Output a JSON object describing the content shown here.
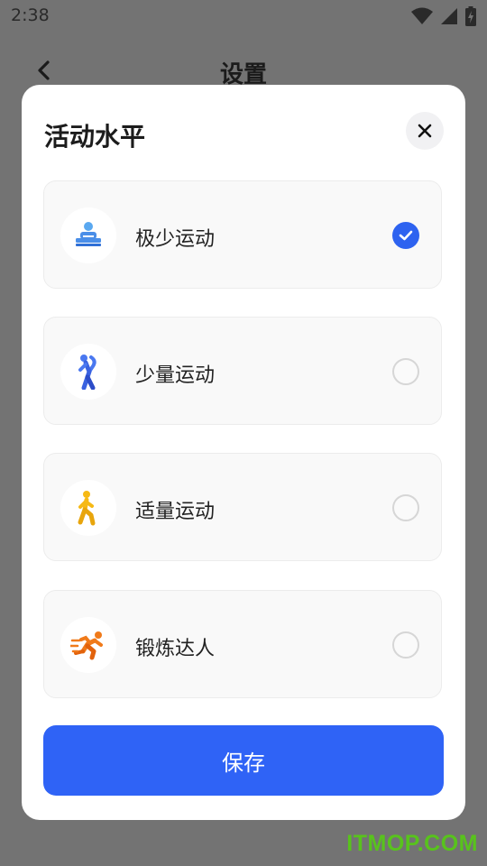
{
  "status_bar": {
    "time": "2:38"
  },
  "app_bar": {
    "title": "设置"
  },
  "sheet": {
    "title": "活动水平",
    "options": [
      {
        "label": "极少运动",
        "icon": "sitting-person-icon",
        "selected": true
      },
      {
        "label": "少量运动",
        "icon": "stretching-person-icon",
        "selected": false
      },
      {
        "label": "适量运动",
        "icon": "walking-person-icon",
        "selected": false
      },
      {
        "label": "锻炼达人",
        "icon": "running-person-icon",
        "selected": false
      }
    ],
    "save_label": "保存"
  },
  "watermark": "ITMOP.COM",
  "colors": {
    "accent": "#2f63f6",
    "overlay": "#737373"
  }
}
